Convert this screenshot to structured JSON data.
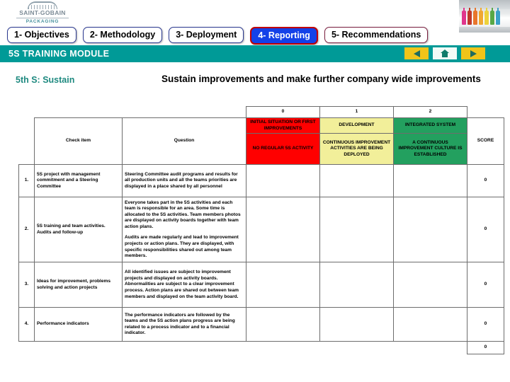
{
  "brand": {
    "name": "SAINT-GOBAIN",
    "sub": "PACKAGING",
    "logo_icon": "arch-logo-icon",
    "photo_icon": "colored-bottles-photo"
  },
  "tabs": [
    {
      "label": "1- Objectives",
      "active": false
    },
    {
      "label": "2- Methodology",
      "active": false
    },
    {
      "label": "3- Deployment",
      "active": false
    },
    {
      "label": "4- Reporting",
      "active": true
    },
    {
      "label": "5- Recommendations",
      "active": false
    }
  ],
  "module_bar": {
    "title": "5S TRAINING MODULE",
    "nav": {
      "back_icon": "triangle-left-icon",
      "home_icon": "home-icon",
      "forward_icon": "triangle-right-icon"
    }
  },
  "title_row": {
    "section_label": "5th S: Sustain",
    "heading": "Sustain improvements and make further company wide improvements"
  },
  "colors": {
    "teal": "#009a97",
    "level0_red": "#ff0000",
    "level1_yellow": "#f2ef9a",
    "level2_green": "#23a05f",
    "tab_active_blue": "#1341e8",
    "tab_active_border": "#c00000",
    "tab_border": "#2b3990",
    "section_label": "#1f8a80",
    "nav_yellow": "#f0c419"
  },
  "table": {
    "headers": {
      "check_item": "Check item",
      "question": "Question",
      "score": "SCORE"
    },
    "levels": [
      {
        "number": "0",
        "label": "INITIAL  SITUATION OR FIRST IMPROVEMENTS",
        "desc": "NO REGULAR 5S ACTIVITY"
      },
      {
        "number": "1",
        "label": "DEVELOPMENT",
        "desc": "CONTINUOUS IMPROVEMENT ACTIVITIES ARE BEING DEPLOYED"
      },
      {
        "number": "2",
        "label": "INTEGRATED SYSTEM",
        "desc": "A CONTINUOUS IMPROVEMENT CULTURE IS ESTABLISHED"
      }
    ],
    "rows": [
      {
        "num": "1.",
        "item": "5S project with management commitment and a Steering Committee",
        "question": "Steering Committee audit programs and results for all production units and all the teams priorities are displayed in a place shared by all personnel",
        "question2": "",
        "score": "0"
      },
      {
        "num": "2.",
        "item": "5S training and team activities. Audits and follow-up",
        "question": "Everyone takes part in the 5S activities and each team is responsible for an area. Some time is allocated to the 5S activities. Team members photos are displayed on activity boards together with team action plans.",
        "question2": "Audits are made regularly and lead to improvement projects or action plans. They are displayed, with specific responsibilities shared out among team members.",
        "score": "0"
      },
      {
        "num": "3.",
        "item": "Ideas for improvement, problems solving and action projects",
        "question": "All identified issues are subject to improvement projects and displayed on activity boards. Abnormalities are subject to a clear improvement process. Action plans are shared out between team members and displayed on the team activity board.",
        "question2": "",
        "score": "0"
      },
      {
        "num": "4.",
        "item": "Performance indicators",
        "question": "The performance indicators are followed by the teams and the 5S action plans progress are being related to a process indicator and to a financial indicator.",
        "question2": "",
        "score": "0"
      }
    ],
    "total": "0"
  }
}
